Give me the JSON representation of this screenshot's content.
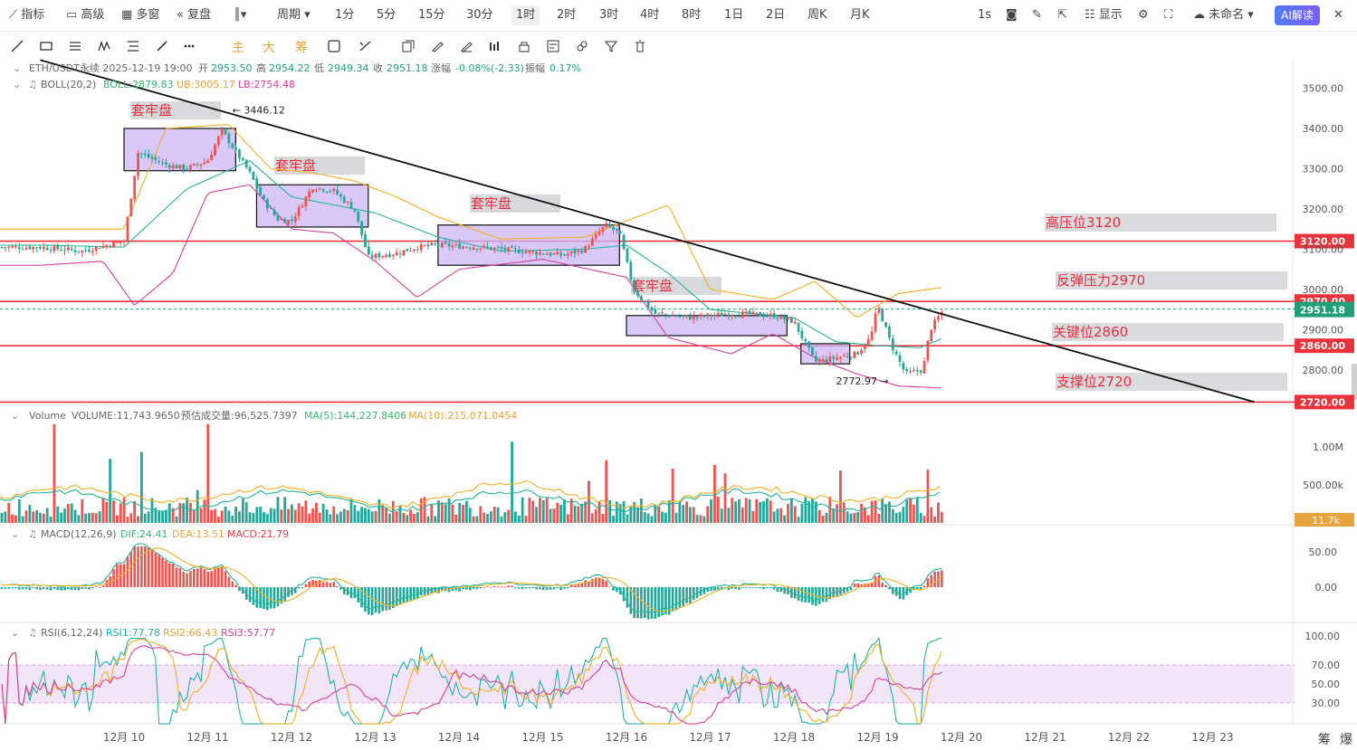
{
  "topbar": {
    "indicators": "指标",
    "advanced": "高级",
    "multi_window": "多窗",
    "replay": "复盘",
    "period": "周期",
    "intervals": [
      "1分",
      "5分",
      "15分",
      "30分",
      "1时",
      "2时",
      "3时",
      "4时",
      "8时",
      "1日",
      "2日",
      "周K",
      "月K"
    ],
    "active_interval": "1时",
    "seconds": "1s",
    "display": "显示",
    "layout_name": "未命名",
    "ai_button": "AI解读"
  },
  "toolbar2": {
    "signals": [
      "主",
      "大",
      "筹"
    ]
  },
  "header": {
    "symbol_line": "ETH/USDT永续 2025-12-19 19:00",
    "open_label": "开",
    "open": "2953.50",
    "high_label": "高",
    "high": "2954.22",
    "low_label": "低",
    "low": "2949.34",
    "close_label": "收",
    "close": "2951.18",
    "change_label": "涨幅",
    "change": "-0.08%(-2.33)",
    "amp_label": "振幅",
    "amp": "0.17%",
    "boll_name": "BOLL(20,2)",
    "boll": "BOLL:2879.83",
    "ub": "UB:3005.17",
    "lb": "LB:2754.48",
    "vol_name": "Volume",
    "vol": "VOLUME:11,743.9650",
    "vol_est": "预估成交量:96,525.7397",
    "vol_ma5": "MA(5):144,227.8406",
    "vol_ma10": "MA(10):215,071.0454",
    "macd_name": "MACD(12,26,9)",
    "dif": "DIF:24.41",
    "dea": "DEA:13.51",
    "macd": "MACD:21.79",
    "rsi_name": "RSI(6,12,24)",
    "rsi1": "RSI1:77.78",
    "rsi2": "RSI2:66.43",
    "rsi3": "RSI3:57.77"
  },
  "chart_data": {
    "type": "candlestick",
    "symbol": "ETH/USDT永续",
    "interval": "1时",
    "x_labels": [
      "12月 10",
      "12月 11",
      "12月 12",
      "12月 13",
      "12月 14",
      "12月 15",
      "12月 16",
      "12月 17",
      "12月 18",
      "12月 19",
      "12月 20",
      "12月 21",
      "12月 22",
      "12月 23"
    ],
    "price_ticks": [
      3500,
      3400,
      3300,
      3200,
      3100,
      3000,
      2900,
      2800
    ],
    "price_tick_labels": [
      "3500.00",
      "3400.00",
      "3300.00",
      "3200.00",
      "3100.00",
      "3000.00",
      "2900.00",
      "2800.00"
    ],
    "ylim": [
      2720,
      3530
    ],
    "close_path": [
      [
        "12月 09 00:00",
        3105
      ],
      [
        "12月 09 12:00",
        3095
      ],
      [
        "12月 10 00:00",
        3120
      ],
      [
        "12月 10 04:00",
        3340
      ],
      [
        "12月 10 12:00",
        3310
      ],
      [
        "12月 10 18:00",
        3300
      ],
      [
        "12月 11 00:00",
        3320
      ],
      [
        "12月 11 04:00",
        3395
      ],
      [
        "12月 11 12:00",
        3290
      ],
      [
        "12月 11 16:00",
        3220
      ],
      [
        "12月 11 20:00",
        3175
      ],
      [
        "12月 12 00:00",
        3170
      ],
      [
        "12月 12 06:00",
        3255
      ],
      [
        "12月 12 12:00",
        3245
      ],
      [
        "12月 12 18:00",
        3200
      ],
      [
        "12月 12 22:00",
        3080
      ],
      [
        "12月 13 06:00",
        3090
      ],
      [
        "12月 13 12:00",
        3105
      ],
      [
        "12月 13 18:00",
        3110
      ],
      [
        "12月 14 06:00",
        3105
      ],
      [
        "12月 14 18:00",
        3095
      ],
      [
        "12月 15 06:00",
        3085
      ],
      [
        "12月 15 12:00",
        3100
      ],
      [
        "12月 15 18:00",
        3160
      ],
      [
        "12月 15 22:00",
        3140
      ],
      [
        "12月 16 02:00",
        3000
      ],
      [
        "12月 16 08:00",
        2940
      ],
      [
        "12月 16 18:00",
        2930
      ],
      [
        "12月 17 06:00",
        2940
      ],
      [
        "12月 17 18:00",
        2935
      ],
      [
        "12月 18 00:00",
        2920
      ],
      [
        "12月 18 06:00",
        2820
      ],
      [
        "12月 18 12:00",
        2830
      ],
      [
        "12月 18 18:00",
        2840
      ],
      [
        "12月 18 22:00",
        2880
      ],
      [
        "12月 19 00:00",
        2960
      ],
      [
        "12月 19 04:00",
        2860
      ],
      [
        "12月 19 08:00",
        2790
      ],
      [
        "12月 19 13:00",
        2800
      ],
      [
        "12月 19 15:00",
        2900
      ],
      [
        "12月 19 19:00",
        2951.18
      ]
    ],
    "boll_ub_path": [
      [
        "12月 09 00:00",
        3150
      ],
      [
        "12月 10 00:00",
        3150
      ],
      [
        "12月 10 12:00",
        3400
      ],
      [
        "12月 11 06:00",
        3410
      ],
      [
        "12月 11 18:00",
        3300
      ],
      [
        "12月 12 06:00",
        3290
      ],
      [
        "12月 12 18:00",
        3270
      ],
      [
        "12月 13 06:00",
        3230
      ],
      [
        "12月 13 18:00",
        3180
      ],
      [
        "12月 14 12:00",
        3125
      ],
      [
        "12月 15 12:00",
        3130
      ],
      [
        "12月 16 00:00",
        3170
      ],
      [
        "12月 16 12:00",
        3210
      ],
      [
        "12月 17 00:00",
        3000
      ],
      [
        "12月 17 18:00",
        2975
      ],
      [
        "12月 18 06:00",
        3020
      ],
      [
        "12月 18 18:00",
        2930
      ],
      [
        "12月 19 06:00",
        2990
      ],
      [
        "12月 19 19:00",
        3005.17
      ]
    ],
    "boll_mid_path": [
      [
        "12月 09 00:00",
        3110
      ],
      [
        "12月 10 00:00",
        3105
      ],
      [
        "12月 10 18:00",
        3250
      ],
      [
        "12月 11 12:00",
        3320
      ],
      [
        "12月 12 00:00",
        3230
      ],
      [
        "12月 12 12:00",
        3210
      ],
      [
        "12月 13 00:00",
        3190
      ],
      [
        "12月 13 18:00",
        3130
      ],
      [
        "12月 14 12:00",
        3095
      ],
      [
        "12月 15 12:00",
        3100
      ],
      [
        "12月 16 00:00",
        3110
      ],
      [
        "12月 16 12:00",
        3040
      ],
      [
        "12月 17 00:00",
        2950
      ],
      [
        "12月 18 00:00",
        2930
      ],
      [
        "12月 18 12:00",
        2870
      ],
      [
        "12月 19 00:00",
        2860
      ],
      [
        "12月 19 12:00",
        2855
      ],
      [
        "12月 19 19:00",
        2879.83
      ]
    ],
    "boll_lb_path": [
      [
        "12月 09 00:00",
        3060
      ],
      [
        "12月 09 18:00",
        3070
      ],
      [
        "12月 10 03:00",
        2960
      ],
      [
        "12月 10 14:00",
        3040
      ],
      [
        "12月 11 00:00",
        3240
      ],
      [
        "12月 11 12:00",
        3260
      ],
      [
        "12月 12 00:00",
        3150
      ],
      [
        "12月 12 12:00",
        3140
      ],
      [
        "12月 13 00:00",
        3070
      ],
      [
        "12月 13 12:00",
        2980
      ],
      [
        "12月 14 00:00",
        3050
      ],
      [
        "12月 15 00:00",
        3075
      ],
      [
        "12月 16 00:00",
        3030
      ],
      [
        "12月 16 12:00",
        2880
      ],
      [
        "12月 17 06:00",
        2840
      ],
      [
        "12月 17 18:00",
        2890
      ],
      [
        "12月 18 06:00",
        2830
      ],
      [
        "12月 18 18:00",
        2790
      ],
      [
        "12月 19 06:00",
        2760
      ],
      [
        "12月 19 19:00",
        2754.48
      ]
    ],
    "volume": {
      "ticks": [
        "1.00M",
        "500.00k"
      ],
      "last_label": "11.7k"
    },
    "macd": {
      "ticks": [
        "50.00",
        "0.00"
      ]
    },
    "rsi": {
      "ticks": [
        "100.00",
        "70.00",
        "50.00",
        "30.00"
      ],
      "band": [
        30,
        70
      ]
    },
    "price_markers": {
      "current": {
        "label": "2951.18",
        "value": 2951.18
      },
      "hidden_label": {
        "label": "2970.00",
        "value": 2970
      }
    },
    "levels": [
      {
        "value": 3120,
        "label": "3120.00",
        "note": "高压位3120"
      },
      {
        "value": 2970,
        "label": "2970.00",
        "note": "反弹压力2970"
      },
      {
        "value": 2860,
        "label": "2860.00",
        "note": "关键位2860"
      },
      {
        "value": 2720,
        "label": "2720.00",
        "note": "支撑位2720"
      }
    ],
    "trendline": {
      "from": [
        "12月 09 00:00",
        3570
      ],
      "to": [
        "12月 23 12:00",
        2720
      ]
    },
    "zones": [
      {
        "label": "套牢盘",
        "from": "12月 10 00:00",
        "to": "12月 11 08:00",
        "high": 3400,
        "low": 3295
      },
      {
        "label": "套牢盘",
        "from": "12月 11 14:00",
        "to": "12月 12 22:00",
        "high": 3260,
        "low": 3155
      },
      {
        "label": "套牢盘",
        "from": "12月 13 18:00",
        "to": "12月 15 22:00",
        "high": 3160,
        "low": 3060
      },
      {
        "label": "套牢盘",
        "from": "12月 16 00:00",
        "to": "12月 17 22:00",
        "high": 2935,
        "low": 2885
      },
      {
        "label": "",
        "from": "12月 18 02:00",
        "to": "12月 18 16:00",
        "high": 2865,
        "low": 2815
      }
    ],
    "annotations": [
      {
        "text": "3446.12",
        "at": [
          "12月 11 06:00",
          3446.12
        ]
      },
      {
        "text": "2772.97",
        "at": [
          "12月 19 00:00",
          2772.97
        ]
      }
    ],
    "footer_right": [
      "筹",
      "爆"
    ]
  }
}
